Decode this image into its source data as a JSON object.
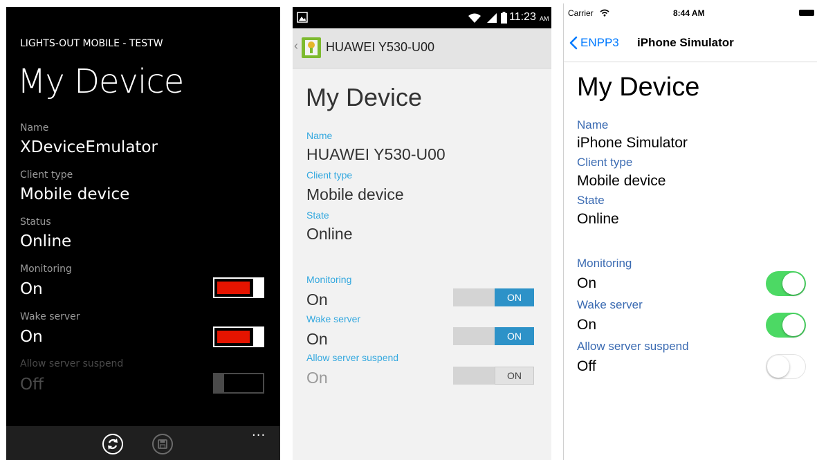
{
  "windows_phone": {
    "app_title": "LIGHTS-OUT MOBILE - TESTW",
    "page_title": "My Device",
    "fields": [
      {
        "label": "Name",
        "value": "XDeviceEmulator"
      },
      {
        "label": "Client type",
        "value": "Mobile device"
      },
      {
        "label": "Status",
        "value": "Online"
      }
    ],
    "toggles": [
      {
        "label": "Monitoring",
        "value": "On",
        "on": true
      },
      {
        "label": "Wake server",
        "value": "On",
        "on": true
      },
      {
        "label": "Allow server suspend",
        "value": "Off",
        "on": false
      }
    ],
    "appbar": {
      "refresh_icon": "refresh-icon",
      "save_icon": "save-icon",
      "more": "..."
    },
    "toggle_color": "#e51400"
  },
  "android": {
    "status_bar": {
      "time": "11:23",
      "ampm": "AM"
    },
    "device_title": "HUAWEI Y530-U00",
    "page_title": "My Device",
    "fields": [
      {
        "label": "Name",
        "value": "HUAWEI Y530-U00"
      },
      {
        "label": "Client type",
        "value": "Mobile device"
      },
      {
        "label": "State",
        "value": "Online"
      }
    ],
    "toggles": [
      {
        "label": "Monitoring",
        "value": "On",
        "switch_text": "ON",
        "on": true
      },
      {
        "label": "Wake server",
        "value": "On",
        "switch_text": "ON",
        "on": true
      },
      {
        "label": "Allow server suspend",
        "value": "On",
        "switch_text": "ON",
        "on": false
      }
    ],
    "accent": "#33a8df"
  },
  "ios": {
    "status_bar": {
      "carrier": "Carrier",
      "time": "8:44 AM"
    },
    "nav": {
      "back_label": "ENPP3",
      "title": "iPhone Simulator"
    },
    "page_title": "My Device",
    "fields": [
      {
        "label": "Name",
        "value": "iPhone Simulator"
      },
      {
        "label": "Client type",
        "value": "Mobile device"
      },
      {
        "label": "State",
        "value": "Online"
      }
    ],
    "toggles": [
      {
        "label": "Monitoring",
        "value": "On",
        "on": true
      },
      {
        "label": "Wake server",
        "value": "On",
        "on": true
      },
      {
        "label": "Allow server suspend",
        "value": "Off",
        "on": false
      }
    ],
    "switch_on_color": "#4cd964",
    "link_color": "#007aff"
  }
}
